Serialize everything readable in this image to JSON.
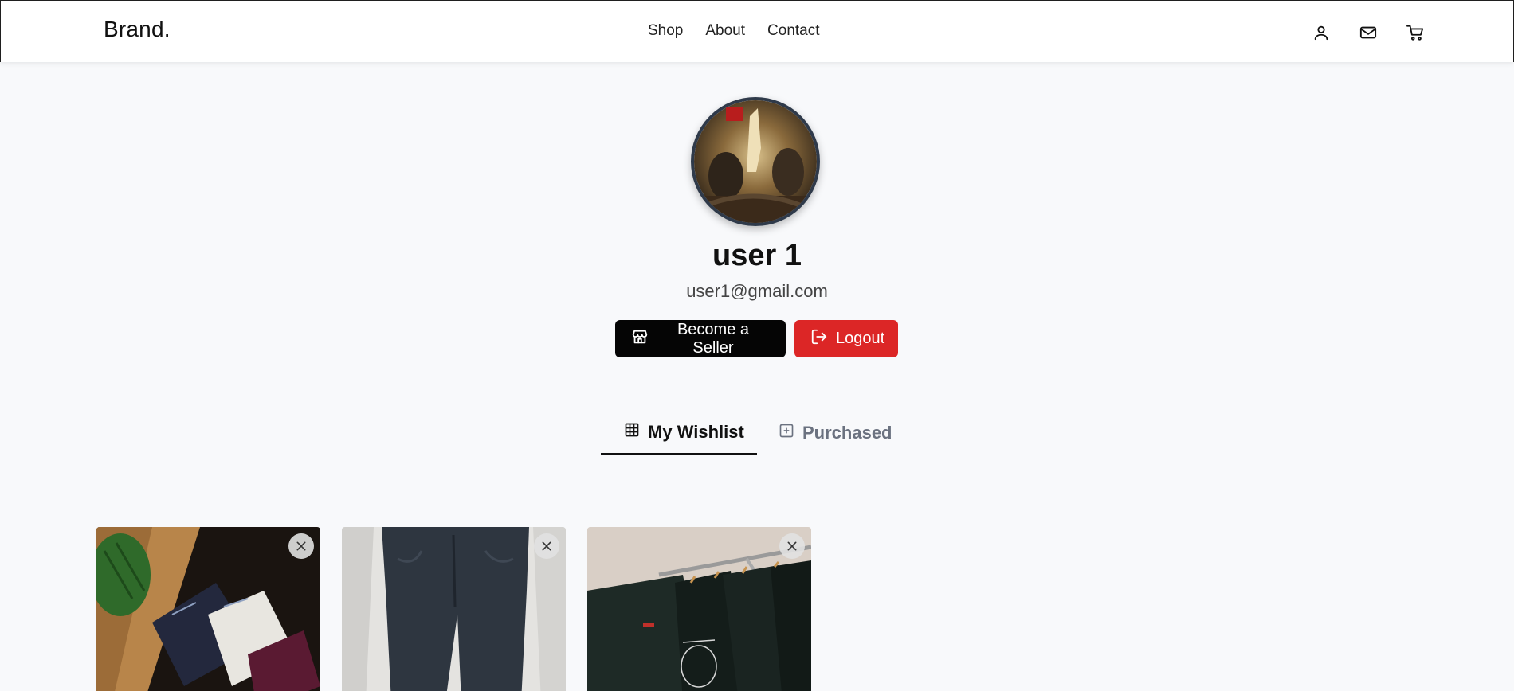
{
  "header": {
    "brand": "Brand.",
    "nav": [
      "Shop",
      "About",
      "Contact"
    ],
    "icons": [
      "user-icon",
      "mail-icon",
      "cart-icon"
    ]
  },
  "profile": {
    "name": "user 1",
    "email": "user1@gmail.com",
    "become_seller_label": "Become a Seller",
    "logout_label": "Logout",
    "avatar_icon": "avatar-painting"
  },
  "tabs": {
    "wishlist_label": "My Wishlist",
    "purchased_label": "Purchased"
  },
  "wishlist": [
    {
      "image": "folded-shirts-photo"
    },
    {
      "image": "dark-jeans-photo"
    },
    {
      "image": "black-tshirts-rack-photo"
    }
  ],
  "colors": {
    "primary": "#050505",
    "danger": "#dc2626",
    "background": "#f8f9fb"
  }
}
